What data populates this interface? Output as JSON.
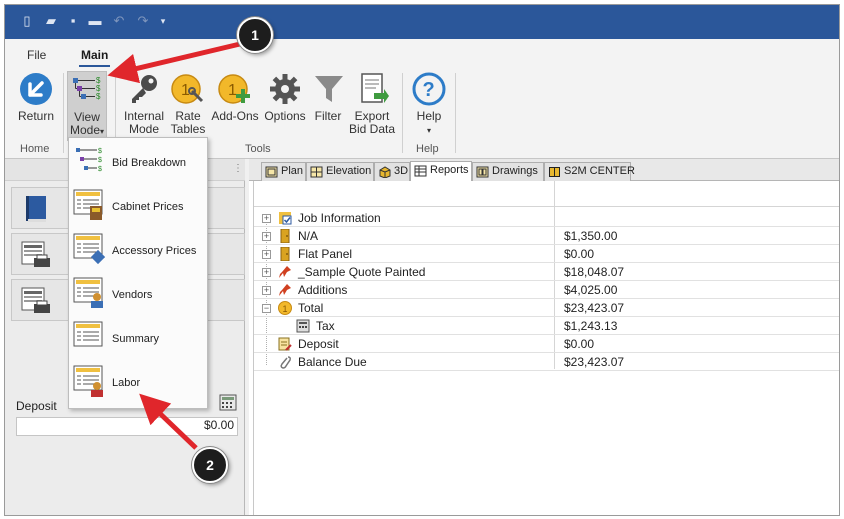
{
  "ribbon": {
    "tabs": [
      {
        "label": "File",
        "active": false
      },
      {
        "label": "Main",
        "active": true
      }
    ],
    "buttons": {
      "return": "Return",
      "view_mode_1": "View",
      "view_mode_2": "Mode",
      "view_mode_caret": "▾",
      "internal_mode_1": "Internal",
      "internal_mode_2": "Mode",
      "rate_tables_1": "Rate",
      "rate_tables_2": "Tables",
      "add_ons": "Add-Ons",
      "options": "Options",
      "filter": "Filter",
      "export_1": "Export",
      "export_2": "Bid Data",
      "help": "Help",
      "help_caret": "▾"
    },
    "groups": {
      "home": "Home",
      "tools": "Tools",
      "help": "Help"
    }
  },
  "view_menu": {
    "items": [
      {
        "label": "Bid Breakdown",
        "icon": "bid-breakdown-icon"
      },
      {
        "label": "Cabinet Prices",
        "icon": "cabinet-prices-icon"
      },
      {
        "label": "Accessory Prices",
        "icon": "accessory-prices-icon"
      },
      {
        "label": "Vendors",
        "icon": "vendors-icon"
      },
      {
        "label": "Summary",
        "icon": "summary-icon"
      },
      {
        "label": "Labor",
        "icon": "labor-icon"
      }
    ]
  },
  "left_panel": {
    "deposit_label": "Deposit",
    "deposit_value": "$0.00"
  },
  "doc_tabs": [
    {
      "label": "Plan",
      "active": false
    },
    {
      "label": "Elevation",
      "active": false
    },
    {
      "label": "3D",
      "active": false
    },
    {
      "label": "Reports",
      "active": true
    },
    {
      "label": "Drawings",
      "active": false
    },
    {
      "label": "S2M CENTER",
      "active": false
    }
  ],
  "report_rows": [
    {
      "label": "Job Information",
      "value": "",
      "icon": "job-information-icon",
      "expandable": true
    },
    {
      "label": "N/A",
      "value": "$1,350.00",
      "icon": "cabinet-icon",
      "expandable": true
    },
    {
      "label": "Flat Panel",
      "value": "$0.00",
      "icon": "cabinet-icon",
      "expandable": true
    },
    {
      "label": "_Sample Quote Painted",
      "value": "$18,048.07",
      "icon": "pin-icon",
      "expandable": true
    },
    {
      "label": "Additions",
      "value": "$4,025.00",
      "icon": "pin-icon",
      "expandable": true
    },
    {
      "label": "Total",
      "value": "$23,423.07",
      "icon": "total-coin-icon",
      "expandable": true
    },
    {
      "label": "Tax",
      "value": "$1,243.13",
      "icon": "calculator-icon",
      "expandable": false
    },
    {
      "label": "Deposit",
      "value": "$0.00",
      "icon": "deposit-note-icon",
      "expandable": false
    },
    {
      "label": "Balance Due",
      "value": "$23,423.07",
      "icon": "paperclip-icon",
      "expandable": false
    }
  ],
  "callouts": {
    "one": "1",
    "two": "2"
  },
  "colors": {
    "title_bar": "#2b579a",
    "arrow": "#e0262b",
    "coin": "#f2b82a"
  }
}
